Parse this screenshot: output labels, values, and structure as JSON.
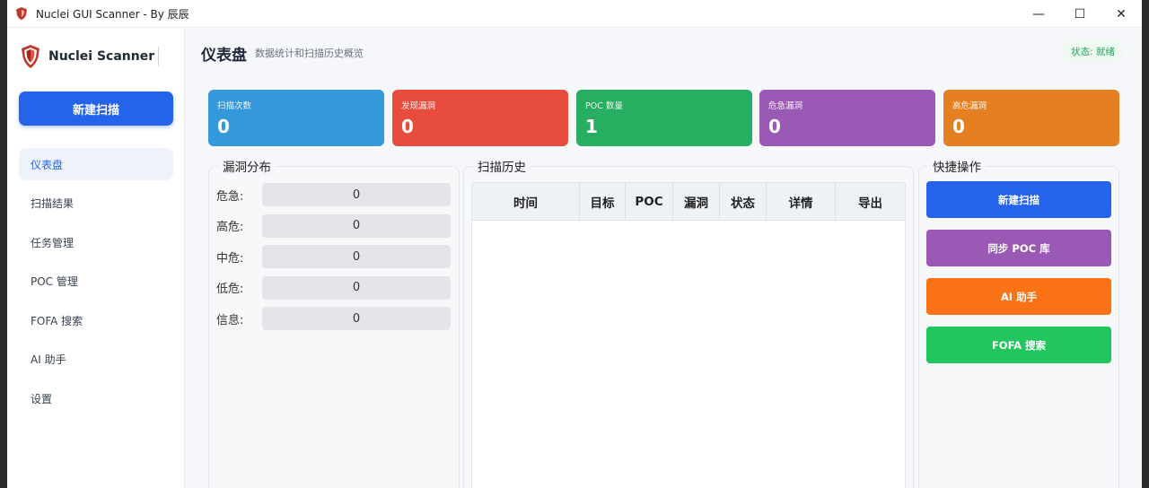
{
  "window": {
    "title": "Nuclei GUI Scanner - By 辰辰",
    "controls": {
      "minimize": "—",
      "maximize": "☐",
      "close": "✕"
    }
  },
  "sidebar": {
    "brand": "Nuclei Scanner",
    "new_scan": "新建扫描",
    "items": [
      {
        "label": "仪表盘",
        "active": true
      },
      {
        "label": "扫描结果"
      },
      {
        "label": "任务管理"
      },
      {
        "label": "POC 管理"
      },
      {
        "label": "FOFA 搜索"
      },
      {
        "label": "AI 助手"
      },
      {
        "label": "设置"
      }
    ]
  },
  "header": {
    "title": "仪表盘",
    "subtitle": "数据统计和扫描历史概览",
    "status": "状态: 就绪"
  },
  "stats": [
    {
      "label": "扫描次数",
      "value": "0",
      "color": "#3498db"
    },
    {
      "label": "发现漏洞",
      "value": "0",
      "color": "#e74c3c"
    },
    {
      "label": "POC 数量",
      "value": "1",
      "color": "#27ae60"
    },
    {
      "label": "危急漏洞",
      "value": "0",
      "color": "#9b59b6"
    },
    {
      "label": "高危漏洞",
      "value": "0",
      "color": "#e67e22"
    }
  ],
  "distribution": {
    "title": "漏洞分布",
    "rows": [
      {
        "label": "危急:",
        "value": "0"
      },
      {
        "label": "高危:",
        "value": "0"
      },
      {
        "label": "中危:",
        "value": "0"
      },
      {
        "label": "低危:",
        "value": "0"
      },
      {
        "label": "信息:",
        "value": "0"
      }
    ]
  },
  "history": {
    "title": "扫描历史",
    "columns": [
      "时间",
      "目标",
      "POC",
      "漏洞",
      "状态",
      "详情",
      "导出"
    ]
  },
  "quick": {
    "title": "快捷操作",
    "actions": [
      {
        "label": "新建扫描",
        "color": "#2563eb"
      },
      {
        "label": "同步 POC 库",
        "color": "#9b59b6"
      },
      {
        "label": "AI 助手",
        "color": "#f97316"
      },
      {
        "label": "FOFA 搜索",
        "color": "#22c55e"
      }
    ]
  }
}
